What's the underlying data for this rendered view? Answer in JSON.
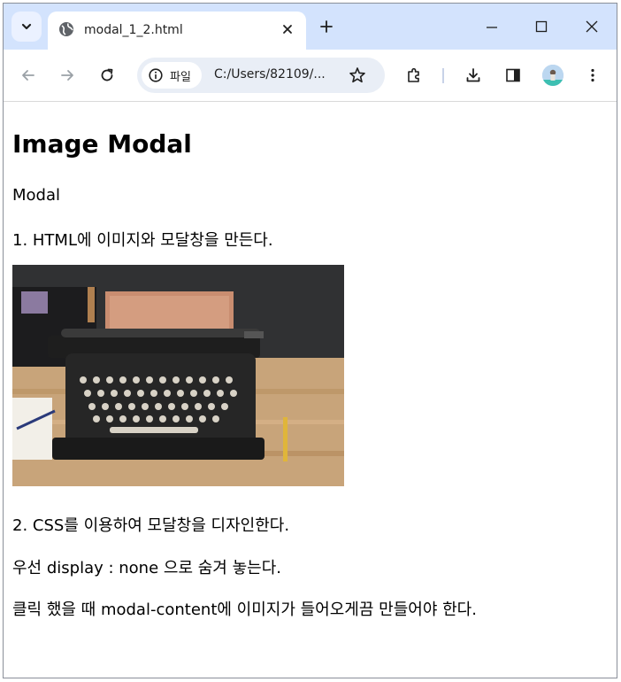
{
  "browser": {
    "tab_title": "modal_1_2.html",
    "site_info_label": "파일",
    "url": "C:/Users/82109/...",
    "icons": [
      "tab-search-icon",
      "globe-icon",
      "close-icon",
      "new-tab-icon",
      "minimize-icon",
      "maximize-icon",
      "window-close-icon",
      "back-icon",
      "forward-icon",
      "reload-icon",
      "info-icon",
      "star-icon",
      "extensions-icon",
      "download-icon",
      "side-panel-icon",
      "profile-avatar",
      "menu-icon"
    ]
  },
  "page": {
    "heading": "Image Modal",
    "subtitle": "Modal",
    "step1": "1. HTML에 이미지와 모달창을 만든다.",
    "step2": "2. CSS를 이용하여 모달창을 디자인한다.",
    "line3": "우선 display : none 으로 숨겨 놓는다.",
    "line4": "클릭 했을 때 modal-content에 이미지가 들어오게끔 만들어야 한다."
  }
}
